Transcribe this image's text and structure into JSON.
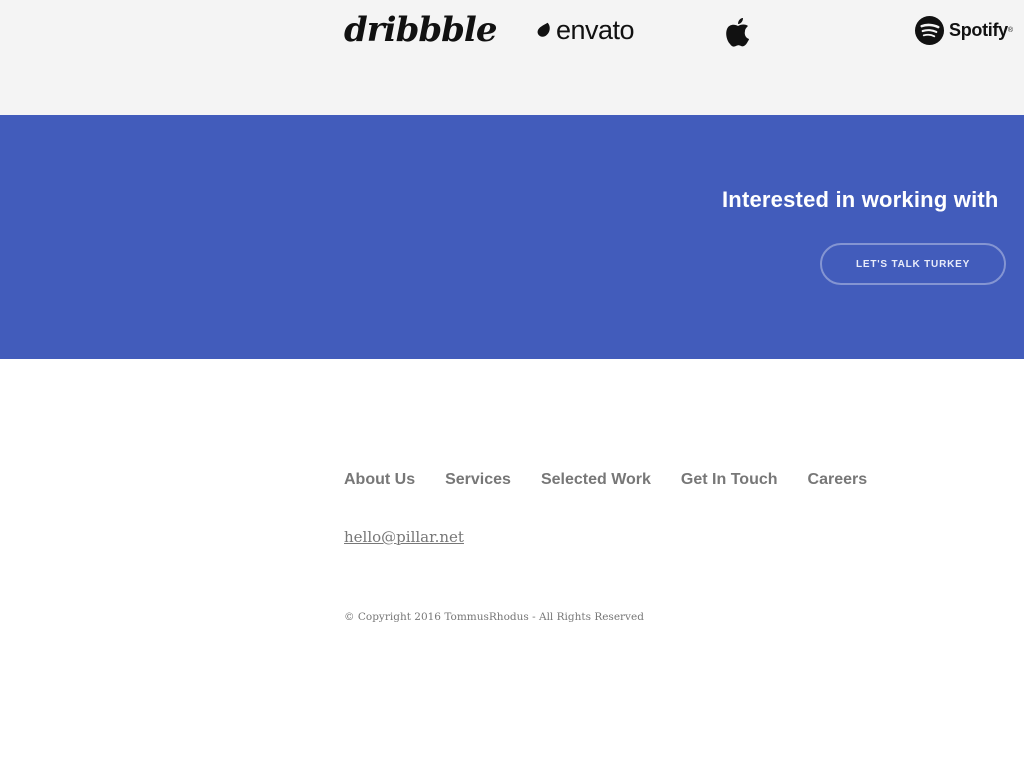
{
  "logos": {
    "dribbble": "dribbble",
    "envato": "envato",
    "spotify": "Spotify",
    "spotify_mark": "®"
  },
  "cta": {
    "heading": "Interested in working with",
    "button_label": "LET'S TALK TURKEY"
  },
  "footer": {
    "nav": [
      {
        "label": "About Us"
      },
      {
        "label": "Services"
      },
      {
        "label": "Selected Work"
      },
      {
        "label": "Get In Touch"
      },
      {
        "label": "Careers"
      }
    ],
    "email": "hello@pillar.net",
    "copyright": "© Copyright 2016 TommusRhodus - All Rights Reserved"
  },
  "colors": {
    "logo_band_bg": "#f4f4f4",
    "cta_bg": "#425cbb",
    "footer_text": "#777777"
  }
}
